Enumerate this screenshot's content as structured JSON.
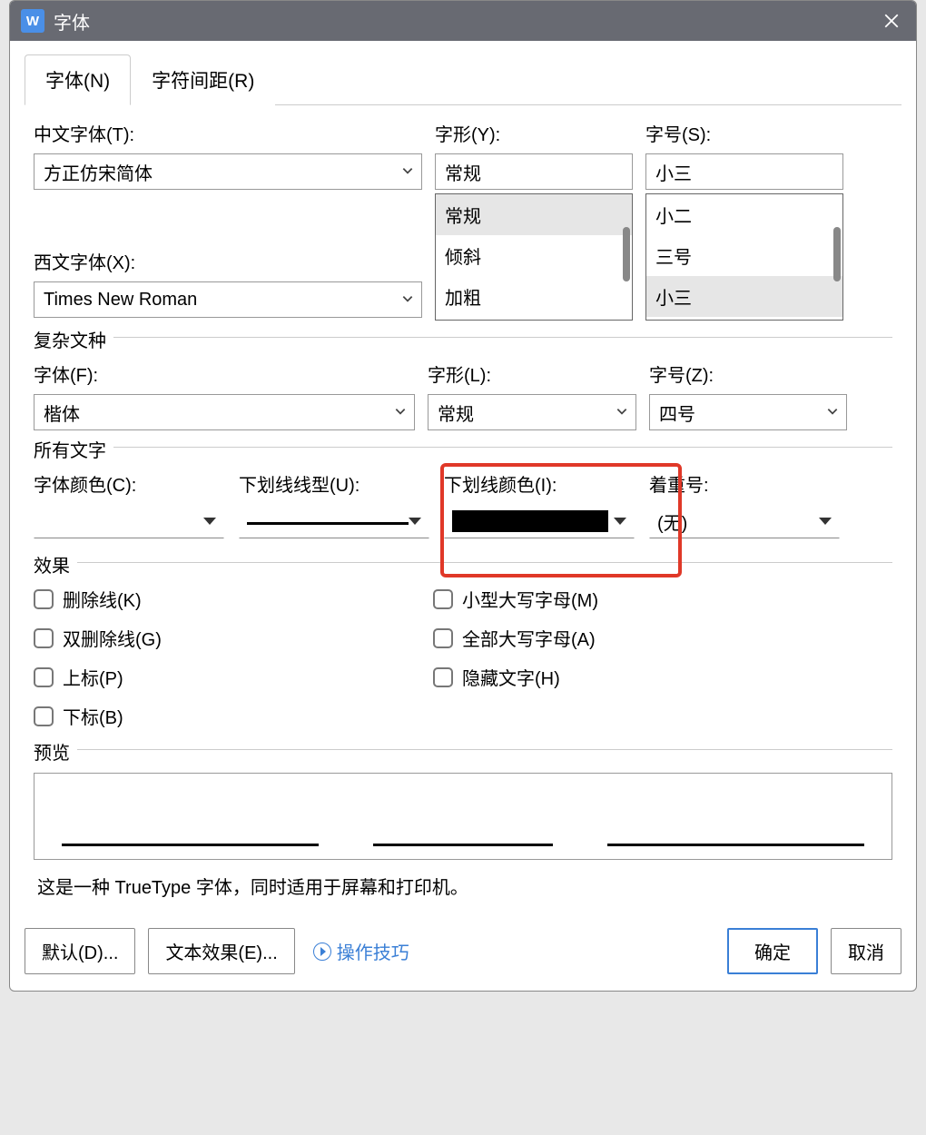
{
  "window": {
    "title": "字体",
    "icon_letter": "W"
  },
  "tabs": {
    "font": "字体(N)",
    "spacing": "字符间距(R)"
  },
  "labels": {
    "cn_font": "中文字体(T):",
    "west_font": "西文字体(X):",
    "style": "字形(Y):",
    "size": "字号(S):"
  },
  "values": {
    "cn_font": "方正仿宋简体",
    "west_font": "Times New Roman",
    "style": "常规",
    "size": "小三"
  },
  "style_options": [
    "常规",
    "倾斜",
    "加粗"
  ],
  "size_options": [
    "小二",
    "三号",
    "小三"
  ],
  "complex": {
    "legend": "复杂文种",
    "font_label": "字体(F):",
    "style_label": "字形(L):",
    "size_label": "字号(Z):",
    "font": "楷体",
    "style": "常规",
    "size": "四号"
  },
  "alltext": {
    "legend": "所有文字",
    "color_label": "字体颜色(C):",
    "underline_label": "下划线线型(U):",
    "ul_color_label": "下划线颜色(I):",
    "emphasis_label": "着重号:",
    "emphasis_value": "(无)"
  },
  "effects": {
    "legend": "效果",
    "strike": "删除线(K)",
    "dstrike": "双删除线(G)",
    "super": "上标(P)",
    "sub": "下标(B)",
    "smallcaps": "小型大写字母(M)",
    "allcaps": "全部大写字母(A)",
    "hidden": "隐藏文字(H)"
  },
  "preview": {
    "legend": "预览"
  },
  "hint": "这是一种 TrueType 字体，同时适用于屏幕和打印机。",
  "footer": {
    "default": "默认(D)...",
    "text_effect": "文本效果(E)...",
    "tips": "操作技巧",
    "ok": "确定",
    "cancel": "取消"
  }
}
